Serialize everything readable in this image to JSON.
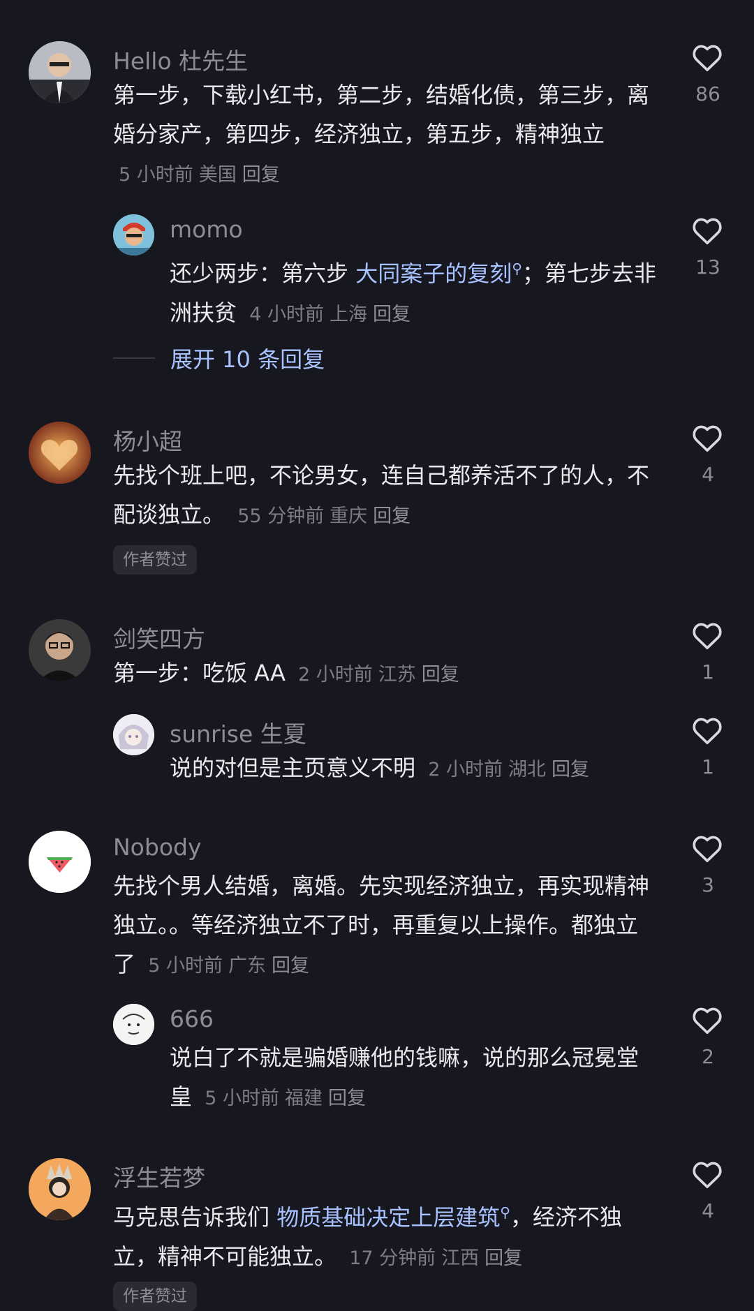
{
  "comments": [
    {
      "name": "Hello 杜先生",
      "text": "第一步，下载小红书，第二步，结婚化债，第三步，离婚分家产，第四步，经济独立，第五步，精神独立",
      "time": "5 小时前",
      "loc": "美国",
      "reply": "回复",
      "likes": "86",
      "replies": [
        {
          "name": "momo",
          "text_pre": "还少两步：第六步 ",
          "link": "大同案子的复刻",
          "text_post": "；第七步去非洲扶贫",
          "time": "4 小时前",
          "loc": "上海",
          "reply": "回复",
          "likes": "13"
        }
      ],
      "expand": "展开 10 条回复"
    },
    {
      "name": "杨小超",
      "text": "先找个班上吧，不论男女，连自己都养活不了的人，不配谈独立。",
      "time": "55 分钟前",
      "loc": "重庆",
      "reply": "回复",
      "likes": "4",
      "tag": "作者赞过"
    },
    {
      "name": "剑笑四方",
      "text": "第一步：吃饭 AA",
      "time": "2 小时前",
      "loc": "江苏",
      "reply": "回复",
      "likes": "1",
      "replies": [
        {
          "name": "sunrise 生夏",
          "text": "说的对但是主页意义不明",
          "time": "2 小时前",
          "loc": "湖北",
          "reply": "回复",
          "likes": "1"
        }
      ]
    },
    {
      "name": "Nobody",
      "text": "先找个男人结婚，离婚。先实现经济独立，再实现精神独立。。等经济独立不了时，再重复以上操作。都独立了",
      "time": "5 小时前",
      "loc": "广东",
      "reply": "回复",
      "likes": "3",
      "replies": [
        {
          "name": "666",
          "text": "说白了不就是骗婚赚他的钱嘛，说的那么冠冕堂皇",
          "time": "5 小时前",
          "loc": "福建",
          "reply": "回复",
          "likes": "2"
        }
      ]
    },
    {
      "name": "浮生若梦",
      "text_pre": "马克思告诉我们 ",
      "link": "物质基础决定上层建筑",
      "text_post": "，经济不独立，精神不可能独立。",
      "time": "17 分钟前",
      "loc": "江西",
      "reply": "回复",
      "likes": "4",
      "tag": "作者赞过"
    }
  ],
  "icons": {
    "like": "heart-outline-icon",
    "search_mark": "search-mark-icon"
  },
  "colors": {
    "background": "#17171f",
    "link": "#a8c2ff",
    "secondary": "#8d8d96"
  }
}
